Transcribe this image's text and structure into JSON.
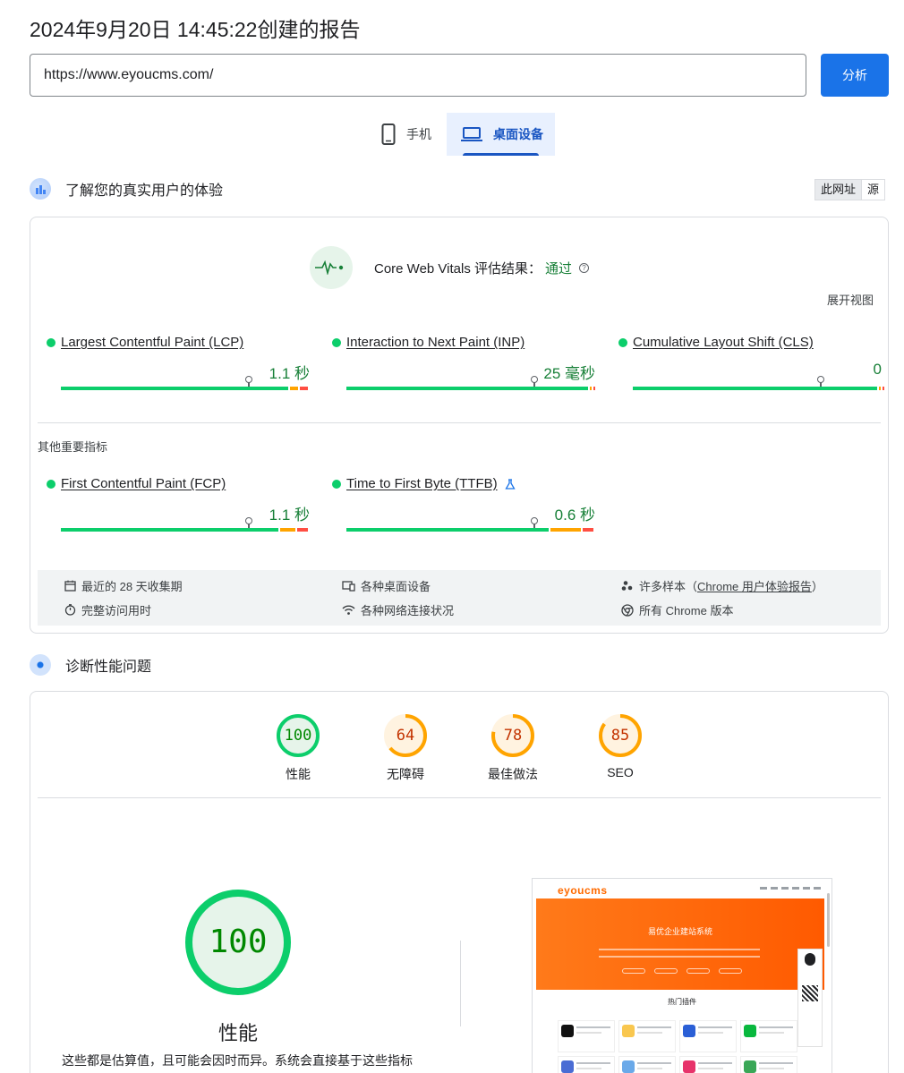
{
  "report": {
    "title": "2024年9月20日 14:45:22创建的报告"
  },
  "search": {
    "url": "https://www.eyoucms.com/",
    "analyze_label": "分析"
  },
  "tabs": [
    {
      "label": "手机",
      "active": false
    },
    {
      "label": "桌面设备",
      "active": true
    }
  ],
  "field_section": {
    "title": "了解您的真实用户的体验",
    "toggle": [
      "此网址",
      "源"
    ],
    "cwv_label": "Core Web Vitals 评估结果：",
    "cwv_result": "通过",
    "expand_label": "展开视图",
    "core_metrics": [
      {
        "name": "Largest Contentful Paint (LCP)",
        "value": "1.1 秒",
        "status": "good",
        "distribution": [
          0.92,
          0.04,
          0.04
        ],
        "marker": 0.75
      },
      {
        "name": "Interaction to Next Paint (INP)",
        "value": "25 毫秒",
        "status": "good",
        "distribution": [
          0.98,
          0.01,
          0.01
        ],
        "marker": 0.75
      },
      {
        "name": "Cumulative Layout Shift (CLS)",
        "value": "0",
        "status": "good",
        "distribution": [
          0.99,
          0.005,
          0.005
        ],
        "marker": 0.75
      }
    ],
    "other_title": "其他重要指标",
    "other_metrics": [
      {
        "name": "First Contentful Paint (FCP)",
        "value": "1.1 秒",
        "status": "good",
        "distribution": [
          0.88,
          0.07,
          0.05
        ],
        "marker": 0.75
      },
      {
        "name": "Time to First Byte (TTFB)",
        "value": "0.6 秒",
        "status": "good",
        "distribution": [
          0.82,
          0.13,
          0.05
        ],
        "marker": 0.75,
        "experimental_icon": "flask-icon"
      }
    ],
    "info": {
      "period": "最近的 28 天收集期",
      "devices": "各种桌面设备",
      "samples_prefix": "许多样本（",
      "samples_link": "Chrome 用户体验报告",
      "samples_suffix": "）",
      "duration": "完整访问用时",
      "network": "各种网络连接状况",
      "versions": "所有 Chrome 版本"
    }
  },
  "lab_section": {
    "title": "诊断性能问题",
    "scores": [
      {
        "label": "性能",
        "value": "100",
        "score": 1.0,
        "color": "#0cce6b",
        "text_color": "#008800",
        "bg": "#e6f4ea"
      },
      {
        "label": "无障碍",
        "value": "64",
        "score": 0.64,
        "color": "#ffa400",
        "text_color": "#c33300",
        "bg": "#fff3e0"
      },
      {
        "label": "最佳做法",
        "value": "78",
        "score": 0.78,
        "color": "#ffa400",
        "text_color": "#c33300",
        "bg": "#fff3e0"
      },
      {
        "label": "SEO",
        "value": "85",
        "score": 0.85,
        "color": "#ffa400",
        "text_color": "#c33300",
        "bg": "#fff3e0"
      }
    ],
    "big_score": {
      "value": "100",
      "label": "性能",
      "score": 1.0
    },
    "estimate_text": "这些都是估算值，且可能会因时而异。系统会直接基于这些指标",
    "screenshot": {
      "logo": "eyoucms",
      "banner_title": "易优企业建站系统",
      "hot_title": "热门插件",
      "accent": "#ff6a00"
    }
  },
  "colors": {
    "good": "#0cce6b",
    "average": "#ffa400",
    "poor": "#ff4e42",
    "link": "#1a73e8"
  }
}
